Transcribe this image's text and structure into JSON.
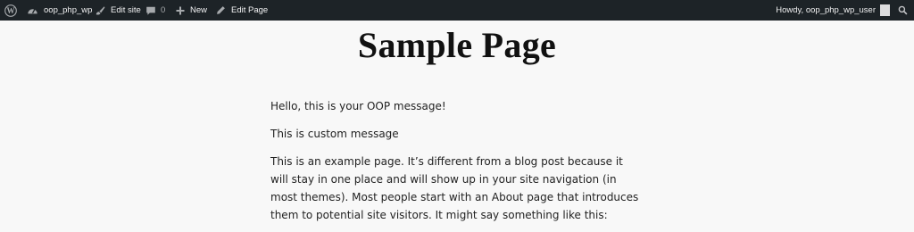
{
  "admin_bar": {
    "site_name": "oop_php_wp",
    "edit_site": "Edit site",
    "comments_count": "0",
    "new": "New",
    "edit_page": "Edit Page",
    "howdy": "Howdy, oop_php_wp_user",
    "icons": [
      "wordpress-logo-icon",
      "dashboard-icon",
      "brush-icon",
      "comment-icon",
      "plus-icon",
      "pencil-icon",
      "avatar",
      "search-icon"
    ]
  },
  "page": {
    "title": "Sample Page",
    "paragraphs": [
      "Hello, this is your OOP message!",
      "This is custom message",
      "This is an example page. It’s different from a blog post because it will stay in one place and will show up in your site navigation (in most themes). Most people start with an About page that introduces them to potential site visitors. It might say something like this:"
    ]
  },
  "colors": {
    "admin_bar_bg": "#1d2327",
    "admin_bar_text": "#f0f0f1",
    "page_bg": "#f8f8f8",
    "text": "#222222"
  }
}
